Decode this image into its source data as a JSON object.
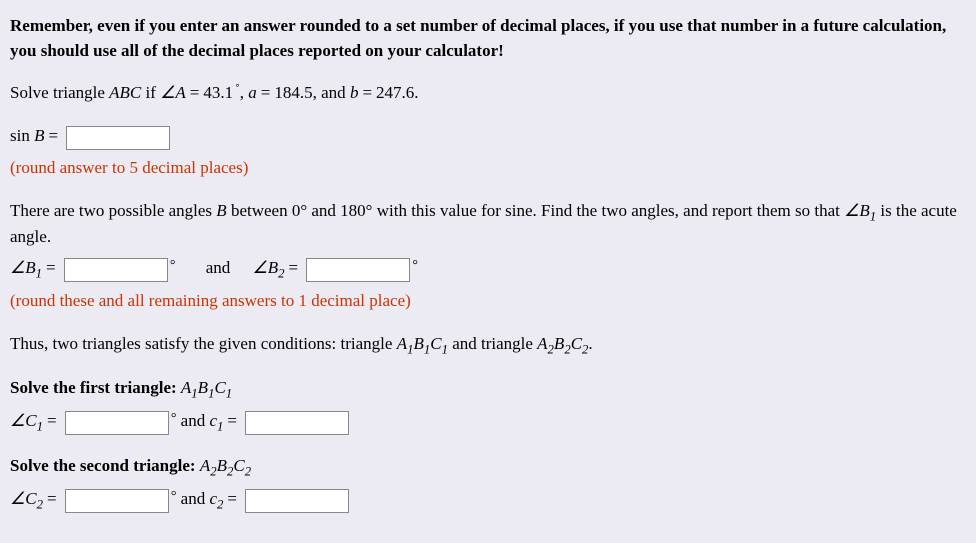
{
  "reminder": "Remember, even if you enter an answer rounded to a set number of decimal places, if you use that number in a future calculation, you should use all of the decimal places reported on your calculator!",
  "problem": {
    "lead": "Solve triangle ",
    "tri": "ABC",
    "iftext": " if ",
    "angAeq": "∠A",
    "Aval": "43.1",
    "aLabel": "a",
    "aVal": "184.5",
    "bLabel": "b",
    "bVal": "247.6",
    "and": ", and "
  },
  "sinB": {
    "label": "sin ",
    "var": "B",
    "hint": "(round answer to 5 decimal places)"
  },
  "twoangles": {
    "text1": "There are two possible angles ",
    "Bvar": "B",
    "text2": " between 0° and 180° with this value for sine. Find the two angles, and report them so that ",
    "B1": "∠B",
    "text3": " is the acute angle.",
    "B1label": "∠B",
    "B2label": "∠B",
    "and": "and",
    "hint": "(round these and all remaining answers to 1 decimal place)"
  },
  "thus": {
    "t1": "Thus, two triangles satisfy the given conditions: triangle ",
    "tri1": "A",
    "t2": " and triangle ",
    "tri2": "A",
    "t3": "."
  },
  "first": {
    "heading": "Solve the first triangle: ",
    "tri": "A",
    "C1": "∠C",
    "and": " and ",
    "c1": "c"
  },
  "second": {
    "heading": "Solve the second triangle: ",
    "tri": "A",
    "C2": "∠C",
    "and": " and ",
    "c2": "c"
  }
}
